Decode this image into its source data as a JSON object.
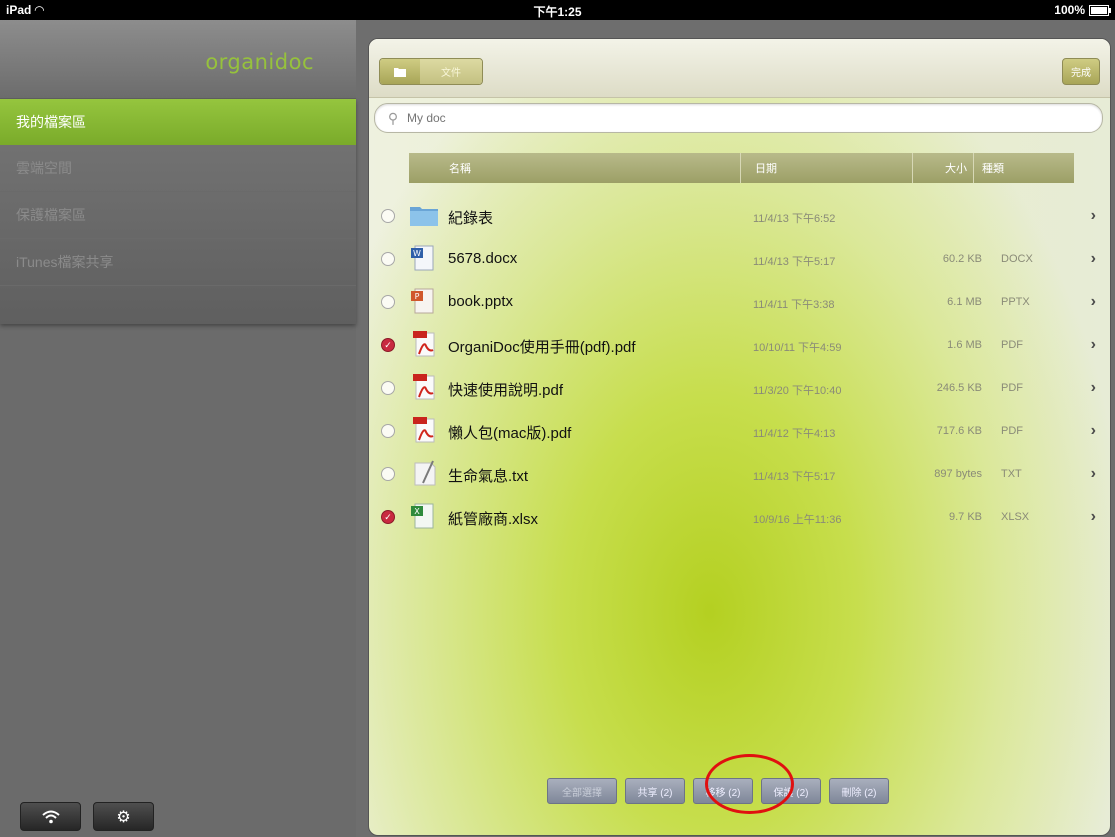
{
  "status_bar": {
    "device": "iPad",
    "time": "下午1:25",
    "battery": "100%"
  },
  "sidebar": {
    "logo": "organidoc",
    "items": [
      {
        "label": "我的檔案區",
        "active": true
      },
      {
        "label": "雲端空間"
      },
      {
        "label": "保護檔案區"
      },
      {
        "label": "iTunes檔案共享"
      }
    ],
    "bottom_buttons": [
      "wifi-icon",
      "gear-icon"
    ]
  },
  "toolbar": {
    "seg_second_label": "文件",
    "done_label": "完成"
  },
  "search": {
    "placeholder": "My doc"
  },
  "columns": {
    "name": "名稱",
    "date": "日期",
    "size": "大小",
    "type": "種類"
  },
  "files": [
    {
      "name": "紀錄表",
      "date": "11/4/13 下午6:52",
      "size": "",
      "type": "",
      "icon": "folder-icon",
      "checked": false
    },
    {
      "name": "5678.docx",
      "date": "11/4/13 下午5:17",
      "size": "60.2 KB",
      "type": "DOCX",
      "icon": "docx-icon",
      "checked": false
    },
    {
      "name": "book.pptx",
      "date": "11/4/11 下午3:38",
      "size": "6.1 MB",
      "type": "PPTX",
      "icon": "pptx-icon",
      "checked": false
    },
    {
      "name": "OrganiDoc使用手冊(pdf).pdf",
      "date": "10/10/11 下午4:59",
      "size": "1.6 MB",
      "type": "PDF",
      "icon": "pdf-icon",
      "checked": true
    },
    {
      "name": "快速使用說明.pdf",
      "date": "11/3/20 下午10:40",
      "size": "246.5 KB",
      "type": "PDF",
      "icon": "pdf-icon",
      "checked": false
    },
    {
      "name": "懶人包(mac版).pdf",
      "date": "11/4/12 下午4:13",
      "size": "717.6 KB",
      "type": "PDF",
      "icon": "pdf-icon",
      "checked": false
    },
    {
      "name": "生命氣息.txt",
      "date": "11/4/13 下午5:17",
      "size": "897 bytes",
      "type": "TXT",
      "icon": "txt-icon",
      "checked": false
    },
    {
      "name": "紙管廠商.xlsx",
      "date": "10/9/16 上午11:36",
      "size": "9.7 KB",
      "type": "XLSX",
      "icon": "xlsx-icon",
      "checked": true
    }
  ],
  "bottom_actions": [
    {
      "label": "全部選擇",
      "enabled": false
    },
    {
      "label": "共享 (2)",
      "enabled": true
    },
    {
      "label": "移移 (2)",
      "enabled": true
    },
    {
      "label": "保護 (2)",
      "enabled": true
    },
    {
      "label": "刪除 (2)",
      "enabled": true
    }
  ]
}
